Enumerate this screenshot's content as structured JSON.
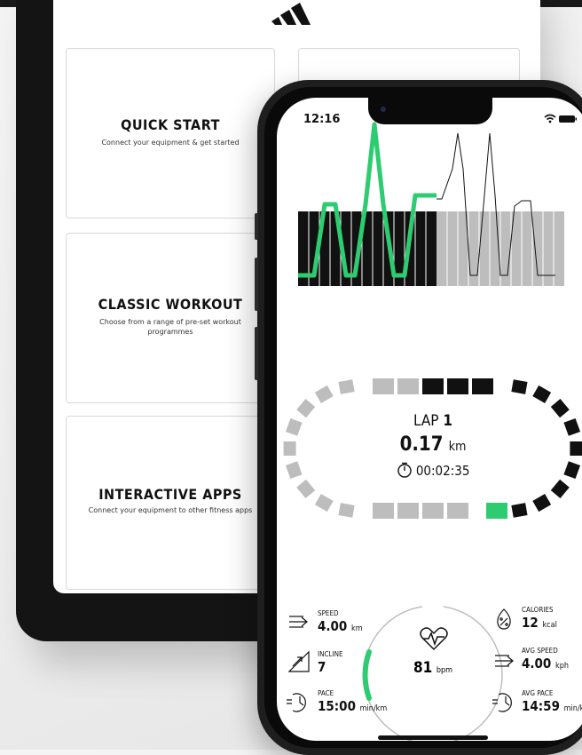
{
  "tablet": {
    "cards": [
      {
        "title": "QUICK START",
        "subtitle": "Connect your equipment & get started"
      },
      {
        "title": "CLASSIC WORKOUT",
        "subtitle": "Choose from a range of pre-set workout programmes"
      },
      {
        "title": "INTERACTIVE APPS",
        "subtitle": "Connect your equipment to other fitness apps"
      }
    ]
  },
  "phone": {
    "status_time": "12:16",
    "lap": {
      "label": "LAP",
      "number": "1",
      "distance": "0.17",
      "distance_unit": "km",
      "timer": "00:02:35"
    },
    "track_progress_segments": 1,
    "heart": {
      "value": "81",
      "unit": "bpm"
    },
    "metrics": {
      "speed": {
        "label": "SPEED",
        "value": "4.00",
        "unit": "km"
      },
      "incline": {
        "label": "INCLINE",
        "value": "7"
      },
      "pace": {
        "label": "PACE",
        "value": "15:00",
        "unit": "min/km"
      },
      "calories": {
        "label": "CALORIES",
        "value": "12",
        "unit": "kcal"
      },
      "avg_speed": {
        "label": "AVG SPEED",
        "value": "4.00",
        "unit": "kph"
      },
      "avg_pace": {
        "label": "AVG PACE",
        "value": "14:59",
        "unit": "min/km"
      }
    },
    "colors": {
      "accent": "#2ecc71",
      "dark": "#111111",
      "muted": "#bdbdbd"
    }
  }
}
